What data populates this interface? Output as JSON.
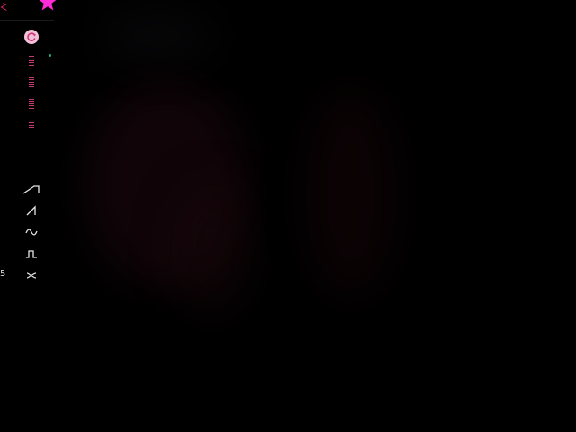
{
  "colors": {
    "background": "#000000",
    "accent_magenta": "#ff2bd6",
    "accent_pink": "#c13a73",
    "sync_button_bg": "#f2c2d8",
    "status_dot": "#2aa78a",
    "icon_white": "#e6e6e6"
  },
  "top_left_glyph": "ᢵ",
  "side_number": "5",
  "toolbar": {
    "top_items": [
      {
        "icon": "sync-icon"
      },
      {
        "icon": "stack-icon"
      },
      {
        "icon": "stack-icon"
      },
      {
        "icon": "stack-icon"
      },
      {
        "icon": "stack-icon"
      }
    ],
    "waveforms": [
      {
        "icon": "ramp-up-icon"
      },
      {
        "icon": "sawtooth-icon"
      },
      {
        "icon": "sine-icon"
      },
      {
        "icon": "square-icon"
      },
      {
        "icon": "random-icon"
      }
    ]
  }
}
